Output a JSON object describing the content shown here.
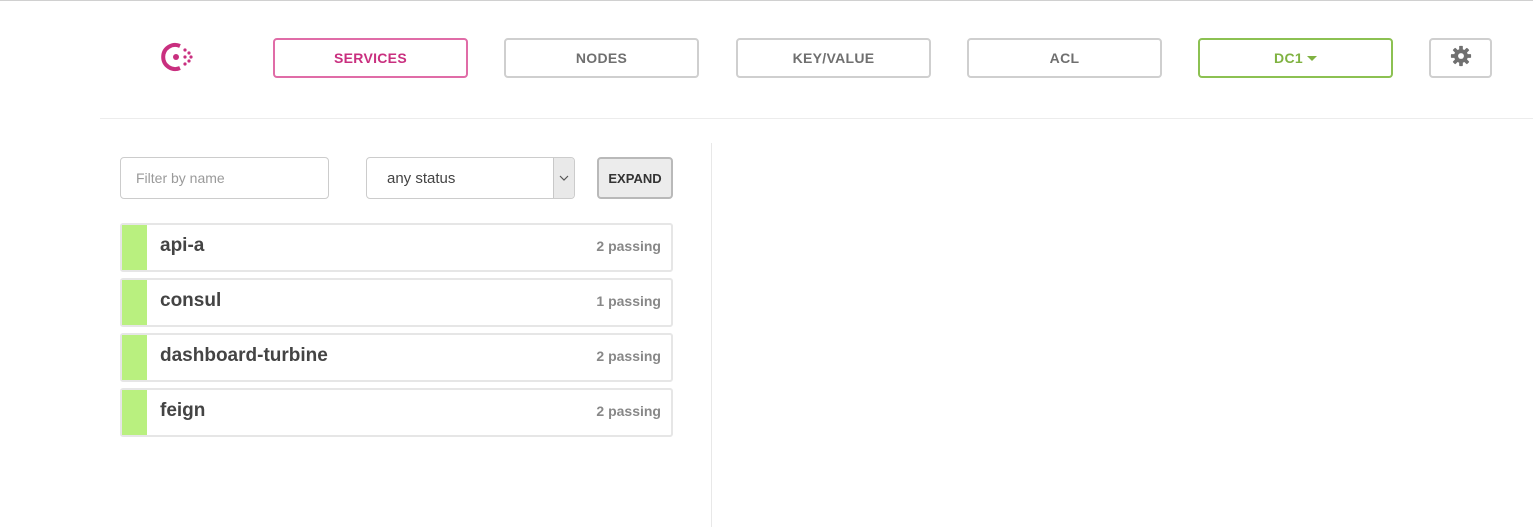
{
  "nav": {
    "services": "SERVICES",
    "nodes": "NODES",
    "keyvalue": "KEY/VALUE",
    "acl": "ACL",
    "datacenter": "DC1"
  },
  "filter": {
    "placeholder": "Filter by name",
    "value": ""
  },
  "status_select": {
    "selected": "any status"
  },
  "expand_label": "EXPAND",
  "services": [
    {
      "name": "api-a",
      "checks": "2 passing"
    },
    {
      "name": "consul",
      "checks": "1 passing"
    },
    {
      "name": "dashboard-turbine",
      "checks": "2 passing"
    },
    {
      "name": "feign",
      "checks": "2 passing"
    }
  ],
  "colors": {
    "brand": "#c92f7f",
    "datacenter": "#7fb241",
    "passing": "#b9f07f"
  },
  "icons": {
    "logo": "consul-logo-icon",
    "settings": "gear-icon",
    "select_arrow": "chevron-down-icon"
  }
}
